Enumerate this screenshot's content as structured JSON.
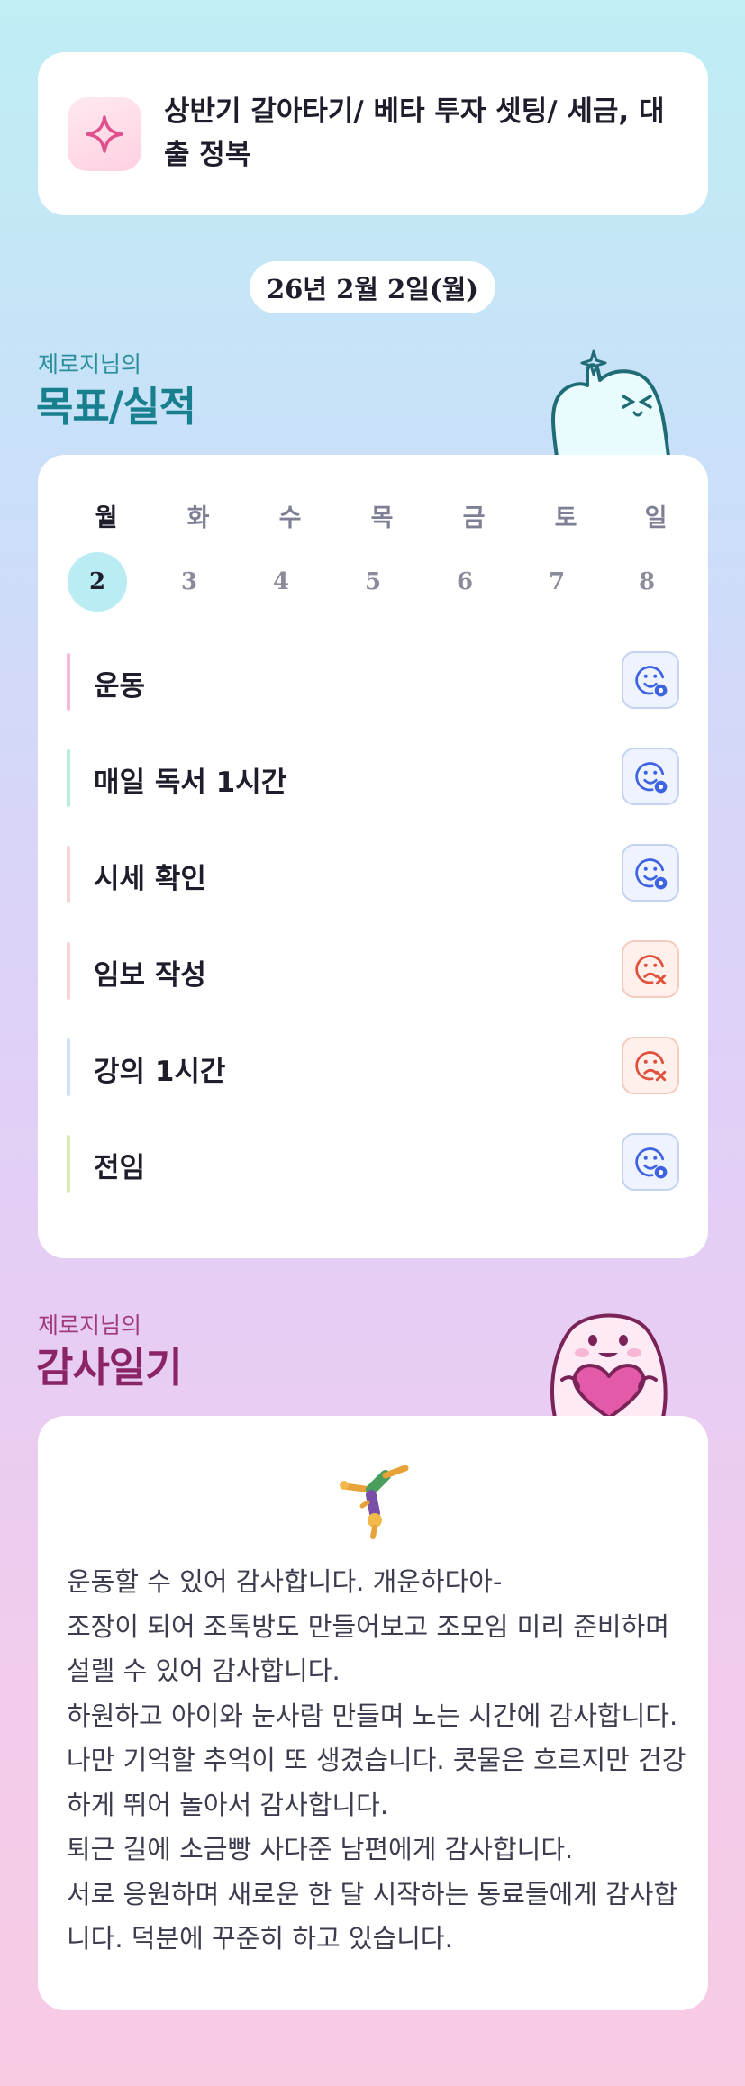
{
  "header": {
    "title": "상반기 갈아타기/ 베타 투자 셋팅/ 세금, 대출 정복",
    "icon": "sparkle-icon"
  },
  "date": "26년 2월 2일(월)",
  "goals_section": {
    "subtitle": "제로지님의",
    "title": "목표/실적"
  },
  "week": {
    "days": [
      "월",
      "화",
      "수",
      "목",
      "금",
      "토",
      "일"
    ],
    "dates": [
      "2",
      "3",
      "4",
      "5",
      "6",
      "7",
      "8"
    ],
    "active_index": 0
  },
  "goals": [
    {
      "label": "운동",
      "status": "done",
      "bar_color": "#f6b9da"
    },
    {
      "label": "매일 독서 1시간",
      "status": "done",
      "bar_color": "#b6ecd9"
    },
    {
      "label": "시세 확인",
      "status": "done",
      "bar_color": "#fcd3d3"
    },
    {
      "label": "임보 작성",
      "status": "missed",
      "bar_color": "#fcd3d3"
    },
    {
      "label": "강의 1시간",
      "status": "missed",
      "bar_color": "#cfe0f7"
    },
    {
      "label": "전임",
      "status": "done",
      "bar_color": "#d8ecb2"
    }
  ],
  "thanks_section": {
    "subtitle": "제로지님의",
    "title": "감사일기"
  },
  "thanks_emoji": "cartwheel-person-icon",
  "thanks_lines": [
    "운동할 수 있어 감사합니다. 개운하다아-",
    "조장이 되어 조톡방도 만들어보고 조모임 미리 준비하며 설렐 수 있어 감사합니다.",
    "하원하고 아이와 눈사람 만들며 노는 시간에 감사합니다. 나만 기억할 추억이 또 생겼습니다. 콧물은 흐르지만 건강하게 뛰어 놀아서 감사합니다.",
    "퇴근 길에 소금빵 사다준 남편에게 감사합니다.",
    "서로 응원하며 새로운 한 달 시작하는 동료들에게 감사합니다. 덕분에 꾸준히 하고 있습니다."
  ],
  "colors": {
    "done_icon": "#3d63e0",
    "missed_icon": "#e0503a",
    "goal_title": "#177f8e",
    "thanks_title": "#8a2466"
  }
}
